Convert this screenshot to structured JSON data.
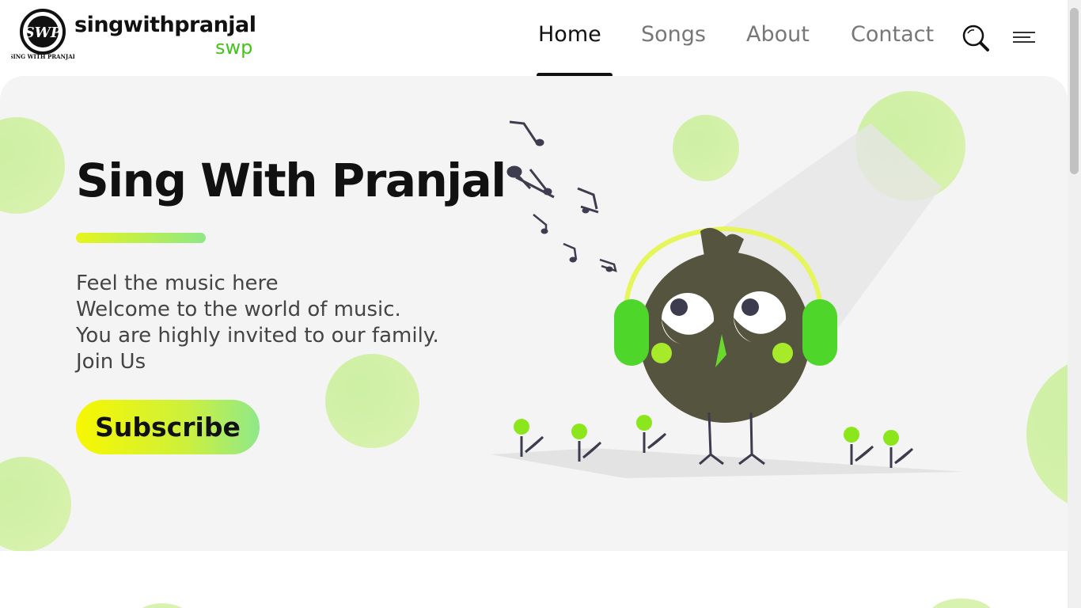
{
  "brand": {
    "name": "singwithpranjal",
    "sub": "swp",
    "badge_initials": "SWP",
    "badge_caption": "SING WITH PRANJAL"
  },
  "nav": {
    "items": [
      "Home",
      "Songs",
      "About",
      "Contact"
    ],
    "active": "Home"
  },
  "icons": {
    "search": "search-icon",
    "menu": "hamburger-menu-icon"
  },
  "hero": {
    "title": "Sing With Pranjal",
    "lines": [
      "Feel the music here",
      "Welcome to the world of music.",
      "You are highly invited to our family.",
      "Join Us"
    ],
    "cta_label": "Subscribe"
  },
  "colors": {
    "accent_green": "#44c31a",
    "blob_green": "#cdf0a0",
    "owl_body": "#55553f",
    "headphone_green": "#4fd62a",
    "cta_gradient_start": "#f7f700",
    "cta_gradient_end": "#8fe88a"
  }
}
